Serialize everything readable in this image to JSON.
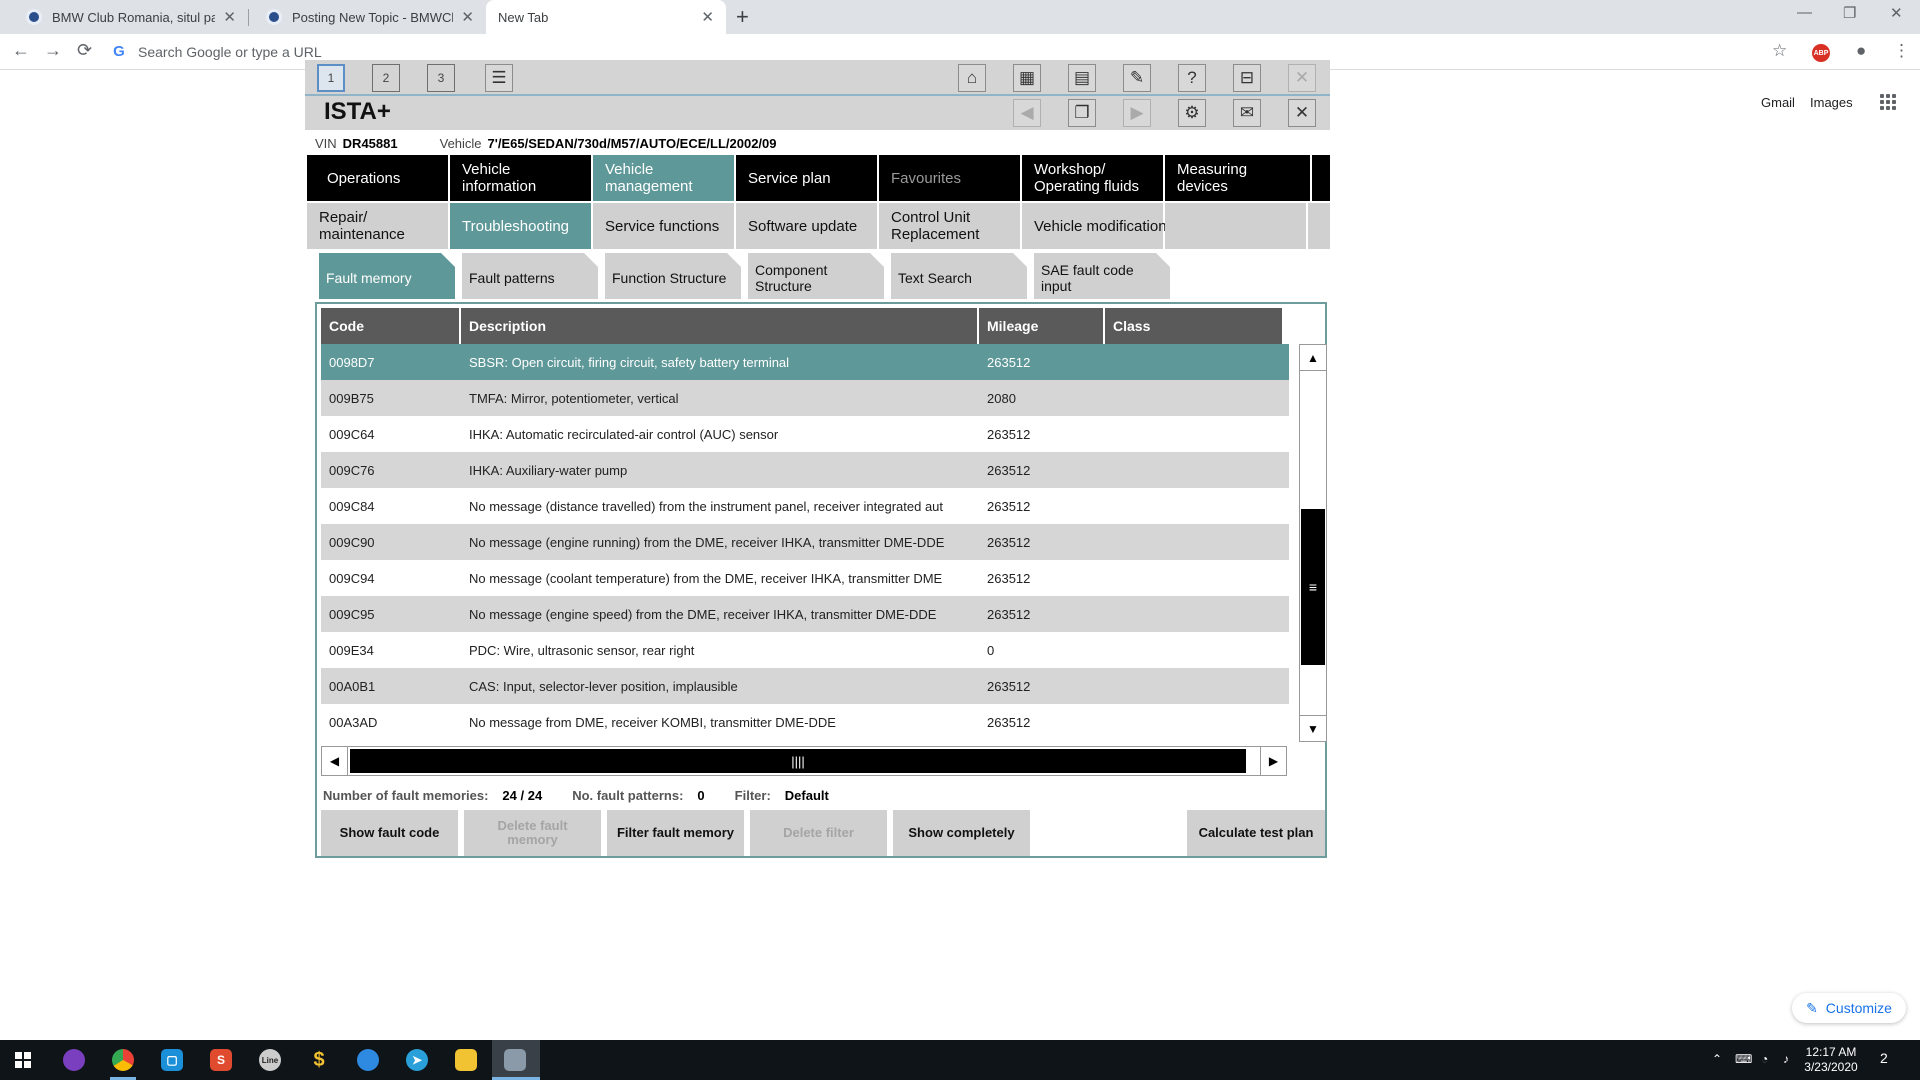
{
  "browser": {
    "tabs": [
      {
        "title": "BMW Club Romania, situl pasion",
        "active": false
      },
      {
        "title": "Posting New Topic - BMWClub",
        "active": false
      },
      {
        "title": "New Tab",
        "active": true
      }
    ],
    "new_tab_symbol": "+",
    "omnibox_placeholder": "Search Google or type a URL",
    "abp_label": "ABP",
    "links": {
      "gmail": "Gmail",
      "images": "Images"
    },
    "customize_label": "Customize"
  },
  "ista": {
    "title": "ISTA+",
    "session_buttons": [
      "1",
      "2",
      "3"
    ],
    "vin_label": "VIN",
    "vin": "DR45881",
    "vehicle_label": "Vehicle",
    "vehicle": "7'/E65/SEDAN/730d/M57/AUTO/ECE/LL/2002/09",
    "menu1": [
      {
        "label": "Operations"
      },
      {
        "label": "Vehicle information"
      },
      {
        "label": "Vehicle management"
      },
      {
        "label": "Service plan"
      },
      {
        "label": "Favourites"
      },
      {
        "label": "Workshop/ Operating fluids"
      },
      {
        "label": "Measuring devices"
      }
    ],
    "menu2": [
      {
        "label": "Repair/ maintenance"
      },
      {
        "label": "Troubleshooting"
      },
      {
        "label": "Service functions"
      },
      {
        "label": "Software update"
      },
      {
        "label": "Control Unit Replacement"
      },
      {
        "label": "Vehicle modification"
      }
    ],
    "tabs": [
      {
        "label": "Fault memory"
      },
      {
        "label": "Fault patterns"
      },
      {
        "label": "Function Structure"
      },
      {
        "label": "Component Structure"
      },
      {
        "label": "Text Search"
      },
      {
        "label": "SAE fault code input"
      }
    ],
    "table": {
      "columns": [
        "Code",
        "Description",
        "Mileage",
        "Class"
      ],
      "rows": [
        {
          "code": "0098D7",
          "description": "SBSR: Open circuit, firing circuit, safety battery terminal",
          "mileage": "263512",
          "class": ""
        },
        {
          "code": "009B75",
          "description": "TMFA: Mirror, potentiometer, vertical",
          "mileage": "2080",
          "class": ""
        },
        {
          "code": "009C64",
          "description": "IHKA: Automatic recirculated-air control (AUC) sensor",
          "mileage": "263512",
          "class": ""
        },
        {
          "code": "009C76",
          "description": "IHKA: Auxiliary-water pump",
          "mileage": "263512",
          "class": ""
        },
        {
          "code": "009C84",
          "description": "No message (distance travelled) from the instrument panel, receiver integrated aut",
          "mileage": "263512",
          "class": ""
        },
        {
          "code": "009C90",
          "description": "No message (engine running) from the DME, receiver IHKA, transmitter DME-DDE",
          "mileage": "263512",
          "class": ""
        },
        {
          "code": "009C94",
          "description": "No message (coolant temperature) from the DME, receiver IHKA, transmitter DME",
          "mileage": "263512",
          "class": ""
        },
        {
          "code": "009C95",
          "description": "No message (engine speed) from the DME, receiver IHKA, transmitter DME-DDE",
          "mileage": "263512",
          "class": ""
        },
        {
          "code": "009E34",
          "description": "PDC: Wire, ultrasonic sensor, rear right",
          "mileage": "0",
          "class": ""
        },
        {
          "code": "00A0B1",
          "description": "CAS: Input, selector-lever position, implausible",
          "mileage": "263512",
          "class": ""
        },
        {
          "code": "00A3AD",
          "description": "No message from DME, receiver KOMBI, transmitter DME-DDE",
          "mileage": "263512",
          "class": ""
        }
      ]
    },
    "status": {
      "fault_memories_label": "Number of fault memories:",
      "fault_memories": "24 / 24",
      "fault_patterns_label": "No. fault patterns:",
      "fault_patterns": "0",
      "filter_label": "Filter:",
      "filter": "Default"
    },
    "buttons": {
      "show_fault_code": "Show fault code",
      "delete_fault_memory": "Delete fault memory",
      "filter_fault_memory": "Filter fault memory",
      "delete_filter": "Delete filter",
      "show_completely": "Show completely",
      "calculate_test_plan": "Calculate test plan"
    },
    "colors": {
      "accent": "#5f9898",
      "menu_black": "#000000",
      "grey": "#d0d0d0"
    }
  },
  "taskbar": {
    "clock_time": "12:17 AM",
    "clock_date": "3/23/2020",
    "notification_count": "2"
  }
}
